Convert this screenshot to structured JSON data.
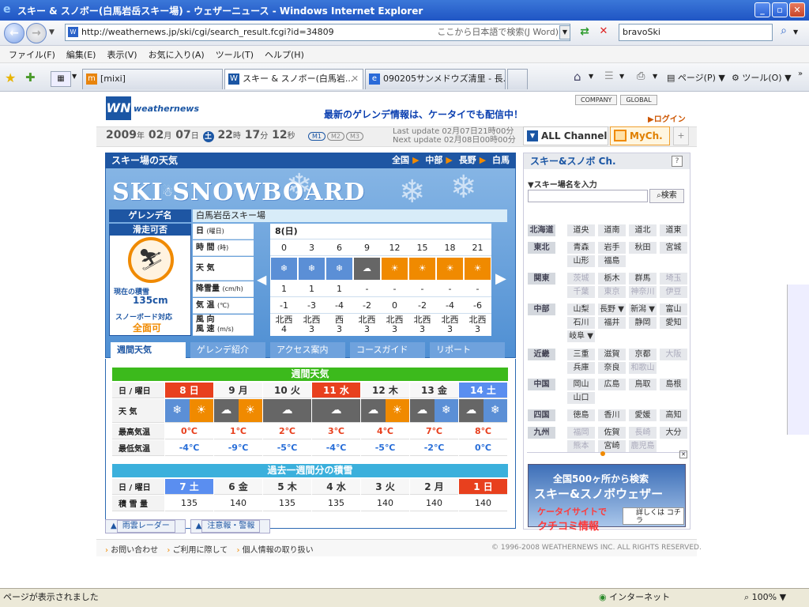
{
  "window": {
    "title": "スキー & スノボー(白馬岩岳スキー場) - ウェザーニュース - Windows Internet Explorer",
    "minimize": "_",
    "maximize": "▫",
    "close": "✕"
  },
  "address": {
    "url": "http://weathernews.jp/ski/cgi/search_result.fcgi?id=34809",
    "hint": "ここから日本語で検索(J Word)",
    "search_value": "bravoSki"
  },
  "menu": [
    "ファイル(F)",
    "編集(E)",
    "表示(V)",
    "お気に入り(A)",
    "ツール(T)",
    "ヘルプ(H)"
  ],
  "tabs": [
    {
      "label": "[mixi]",
      "icon": "mixi-icon"
    },
    {
      "label": "スキー & スノボー(白馬岩...",
      "icon": "weathernews-icon"
    },
    {
      "label": "090205サンメドウズ清里 - 長...",
      "icon": "ie-page-icon"
    }
  ],
  "toolbar_right": {
    "page": "ページ(P)",
    "tools": "ツール(O)"
  },
  "site": {
    "logo": "weathernews",
    "promo": "最新のゲレンデ情報は、ケータイでも配信中！",
    "top_links": [
      "COMPANY",
      "GLOBAL"
    ],
    "login": "ログイン",
    "date": {
      "year": "2009",
      "month": "02",
      "day": "07",
      "dow": "土",
      "hour": "22",
      "minute": "17",
      "second": "12"
    },
    "date_units": {
      "year": "年",
      "month": "月",
      "day": "日",
      "hour": "時",
      "minute": "分",
      "second": "秒"
    },
    "modes": [
      "M1",
      "M2",
      "M3"
    ],
    "last_update": "Last update  02月07日21時00分",
    "next_update": "Next update  02月08日00時00分",
    "all_channel": "ALL Channel",
    "mych": "MyCh.",
    "plus": "+"
  },
  "panel": {
    "title": "スキー場の天気",
    "breadcrumb": [
      "全国",
      "中部",
      "長野",
      "白馬"
    ],
    "ski_logo": "SKI SNOWBOARD",
    "ground_label": "ゲレンデ名",
    "ground_name": "白馬岩岳スキー場",
    "skiable": "滑走可否",
    "snow_depth_label": "現在の積雪",
    "snow_depth": "135cm",
    "snowboard_label": "スノーボード対応",
    "snowboard_value": "全面可"
  },
  "hourly": {
    "row_labels": [
      {
        "main": "日",
        "sub": "(曜日)"
      },
      {
        "main": "時 間",
        "sub": "(時)"
      },
      {
        "main": "天 気",
        "sub": ""
      },
      {
        "main": "降雪量",
        "sub": "(cm/h)"
      },
      {
        "main": "気 温",
        "sub": "(℃)"
      },
      {
        "main": "風 向",
        "sub": ""
      }
    ],
    "wind_speed_label": "風 速",
    "wind_speed_unit": "(m/s)",
    "day": "8(日)",
    "hours": [
      "0",
      "3",
      "6",
      "9",
      "12",
      "15",
      "18",
      "21"
    ],
    "weather": [
      "snow",
      "snow",
      "snow",
      "cloud",
      "sun",
      "sun",
      "sun",
      "sun"
    ],
    "snowfall": [
      "1",
      "1",
      "1",
      "-",
      "-",
      "-",
      "-",
      "-"
    ],
    "temp": [
      "-1",
      "-3",
      "-4",
      "-2",
      "0",
      "-2",
      "-4",
      "-6"
    ],
    "wind_dir": [
      "北西",
      "北西",
      "西",
      "北西",
      "北西",
      "北西",
      "北西",
      "北西"
    ],
    "wind_speed": [
      "4",
      "3",
      "3",
      "3",
      "3",
      "3",
      "3",
      "3"
    ]
  },
  "site_tabs": [
    "週間天気",
    "ゲレンデ紹介",
    "アクセス案内",
    "コースガイド",
    "リポート"
  ],
  "weekly": {
    "heading": "週間天気",
    "row_labels": [
      "日 / 曜日",
      "天 気",
      "最高気温",
      "最低気温"
    ],
    "days": [
      {
        "label": "8 日",
        "style": "red",
        "icon": [
          "snow",
          "sun"
        ],
        "hi": "0℃",
        "lo": "-4℃"
      },
      {
        "label": "9 月",
        "style": "",
        "icon": [
          "cloud",
          "sun"
        ],
        "hi": "1℃",
        "lo": "-9℃"
      },
      {
        "label": "10 火",
        "style": "",
        "icon": [
          "cloud"
        ],
        "hi": "2℃",
        "lo": "-5℃"
      },
      {
        "label": "11 水",
        "style": "red",
        "icon": [
          "cloud"
        ],
        "hi": "3℃",
        "lo": "-4℃"
      },
      {
        "label": "12 木",
        "style": "",
        "icon": [
          "cloud",
          "sun"
        ],
        "hi": "4℃",
        "lo": "-5℃"
      },
      {
        "label": "13 金",
        "style": "",
        "icon": [
          "cloud",
          "snow"
        ],
        "hi": "7℃",
        "lo": "-2℃"
      },
      {
        "label": "14 土",
        "style": "blue",
        "icon": [
          "cloud",
          "snow"
        ],
        "hi": "8℃",
        "lo": "0℃"
      }
    ]
  },
  "past_snow": {
    "heading": "過去一週間分の積雪",
    "row_labels": [
      "日 / 曜日",
      "積 雪 量"
    ],
    "days": [
      {
        "label": "7 土",
        "style": "blue",
        "value": "135"
      },
      {
        "label": "6 金",
        "style": "",
        "value": "140"
      },
      {
        "label": "5 木",
        "style": "",
        "value": "135"
      },
      {
        "label": "4 水",
        "style": "",
        "value": "135"
      },
      {
        "label": "3 火",
        "style": "",
        "value": "140"
      },
      {
        "label": "2 月",
        "style": "",
        "value": "140"
      },
      {
        "label": "1 日",
        "style": "red",
        "value": "140"
      }
    ]
  },
  "bottom_links": [
    "雨雲レーダー",
    "注意報・警報"
  ],
  "right": {
    "title": "スキー&スノボ Ch.",
    "help": "?",
    "name_label": "▼スキー場名を入力",
    "search_button": "検索",
    "regions": [
      {
        "head": "北海道",
        "items": [
          "道央",
          "道南",
          "道北",
          "道東"
        ],
        "dim": []
      },
      {
        "head": "東北",
        "items": [
          "青森",
          "岩手",
          "秋田",
          "宮城",
          "山形",
          "福島"
        ],
        "dim": []
      },
      {
        "head": "関東",
        "items": [
          "茨城",
          "栃木",
          "群馬",
          "埼玉",
          "千葉",
          "東京",
          "神奈川",
          "伊豆"
        ],
        "dim": [
          0,
          3,
          4,
          5,
          6,
          7
        ]
      },
      {
        "head": "中部",
        "items": [
          "山梨",
          "長野 ▼",
          "新潟 ▼",
          "富山",
          "石川",
          "福井",
          "静岡",
          "愛知",
          "岐阜 ▼"
        ],
        "dim": []
      },
      {
        "head": "近畿",
        "items": [
          "三重",
          "滋賀",
          "京都",
          "大阪",
          "兵庫",
          "奈良",
          "和歌山"
        ],
        "dim": [
          3,
          6
        ]
      },
      {
        "head": "中国",
        "items": [
          "岡山",
          "広島",
          "鳥取",
          "島根",
          "山口"
        ],
        "dim": []
      },
      {
        "head": "四国",
        "items": [
          "徳島",
          "香川",
          "愛媛",
          "高知"
        ],
        "dim": []
      },
      {
        "head": "九州",
        "items": [
          "福岡",
          "佐賀",
          "長崎",
          "大分",
          "熊本",
          "宮崎",
          "鹿児島"
        ],
        "dim": [
          0,
          2,
          4,
          6
        ]
      }
    ],
    "banner": {
      "line1": "全国500ヶ所から検索",
      "line2": "スキー&スノボウェザー",
      "line3": "ケータイサイトで",
      "line4": "クチコミ情報",
      "cta": "詳しくは コチラ"
    }
  },
  "footer": {
    "links": [
      "お問い合わせ",
      "ご利用に際して",
      "個人情報の取り扱い"
    ],
    "copyright": "© 1996-2008 WEATHERNEWS INC. ALL RIGHTS RESERVED."
  },
  "status": {
    "left": "ページが表示されました",
    "zone": "インターネット",
    "zoom": "100%"
  },
  "colors": {
    "accent": "#1e56a3",
    "orange": "#f08a00",
    "red": "#e8401e",
    "blue": "#5a8ef0"
  }
}
